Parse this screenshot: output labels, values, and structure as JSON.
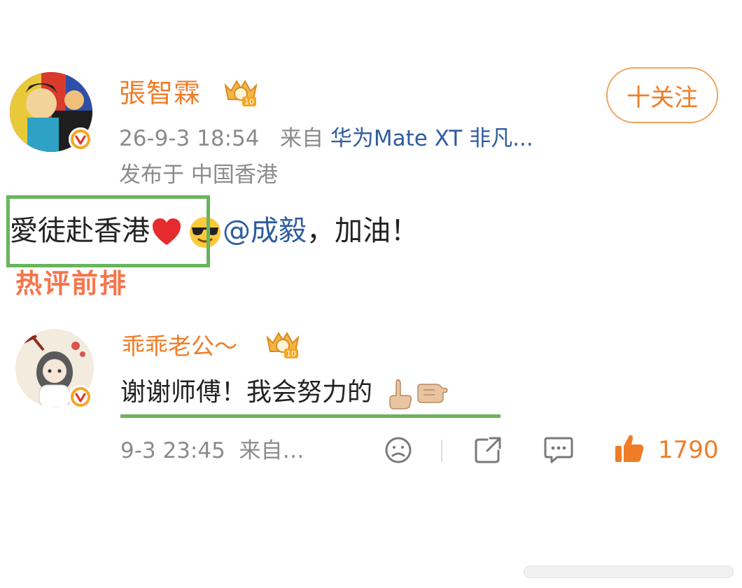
{
  "post": {
    "author_name": "張智霖",
    "follow_label": "十关注",
    "time": "26-9-3 18:54",
    "source_prefix": "来自",
    "device": "华为Mate XT 非凡...",
    "location": "发布于 中国香港",
    "text_main": "愛徒赴香港",
    "text_mention": "@成毅",
    "text_tail": "，加油！"
  },
  "hot_comments_title": "热评前排",
  "comment": {
    "author_name": "乖乖老公～",
    "text": "谢谢师傅！我会努力的",
    "time": "9-3 23:45",
    "source": "来自…",
    "like_count": "1790"
  },
  "colors": {
    "orange": "#ef7d28",
    "blue": "#2f5c9e",
    "green_highlight": "#6ab45c",
    "gray": "#8b8b8b"
  },
  "icons": [
    "verified-v-icon",
    "vip-crown-icon",
    "heart-emoji-icon",
    "sunglasses-emoji-icon",
    "hand-emoji-icon",
    "fist-emoji-icon",
    "dislike-face-icon",
    "share-icon",
    "comment-icon",
    "like-thumb-icon"
  ]
}
